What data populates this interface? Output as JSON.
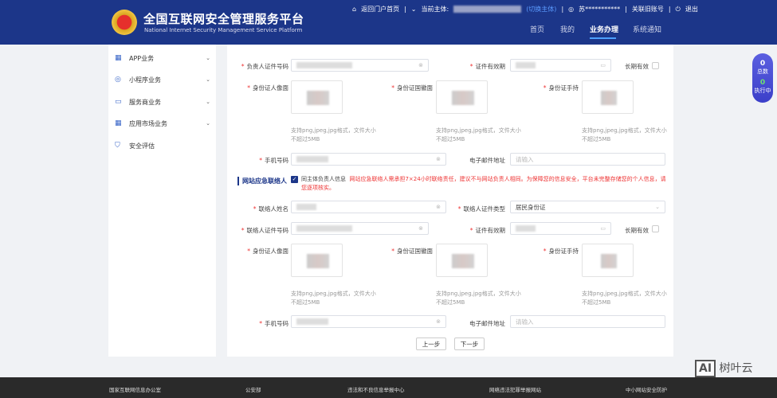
{
  "header": {
    "title": "全国互联网安全管理服务平台",
    "subtitle": "National Internet Security Management Service Platform",
    "top_links": {
      "home_portal": "返回门户首页",
      "current_entity_label": "当前主体:",
      "switch_entity": "(切换主体)",
      "user": "苏***********",
      "link_account": "关联旧账号",
      "logout": "退出"
    },
    "nav": [
      "首页",
      "我的",
      "业务办理",
      "系统通知"
    ],
    "active_nav": "业务办理"
  },
  "sidebar": {
    "items": [
      {
        "label": "APP业务",
        "icon": "grid-icon"
      },
      {
        "label": "小程序业务",
        "icon": "compass-icon"
      },
      {
        "label": "服务商业务",
        "icon": "monitor-icon"
      },
      {
        "label": "应用市场业务",
        "icon": "grid-icon"
      },
      {
        "label": "安全评估",
        "icon": "shield-icon"
      }
    ]
  },
  "form": {
    "owner": {
      "id_number_label": "负责人证件号码",
      "validity_label": "证件有效期",
      "long_term_label": "长期有效",
      "portrait_label": "身份证人像面",
      "emblem_label": "身份证国徽面",
      "handheld_label": "身份证手持",
      "upload_hint": "支持png,jpeg,jpg格式，文件大小不超过5MB",
      "phone_label": "手机号码",
      "email_label": "电子邮件地址",
      "email_placeholder": "请输入"
    },
    "section_title": "网站应急联络人",
    "same_as_owner_label": "同主体负责人信息",
    "warning": "网站应急联络人需承担7×24小时联络责任，建议不与网站负责人相同。为保障您的信息安全，平台未完整存储您的个人信息，请您逐项核实。",
    "contact": {
      "name_label": "联络人姓名",
      "id_type_label": "联络人证件类型",
      "id_type_value": "居民身份证",
      "id_number_label": "联络人证件号码",
      "validity_label": "证件有效期",
      "long_term_label": "长期有效",
      "portrait_label": "身份证人像面",
      "emblem_label": "身份证国徽面",
      "handheld_label": "身份证手持",
      "upload_hint": "支持png,jpeg,jpg格式，文件大小不超过5MB",
      "phone_label": "手机号码",
      "email_label": "电子邮件地址",
      "email_placeholder": "请输入"
    },
    "prev_button": "上一步",
    "next_button": "下一步"
  },
  "float_panel": {
    "total_count": "0",
    "total_label": "总数",
    "running_count": "0",
    "running_label": "执行中"
  },
  "footer": [
    "国家互联网信息办公室",
    "公安部",
    "违法和不良信息举报中心",
    "网络违法犯罪举报网站",
    "中小网站安全防护"
  ],
  "watermark": "树叶云"
}
